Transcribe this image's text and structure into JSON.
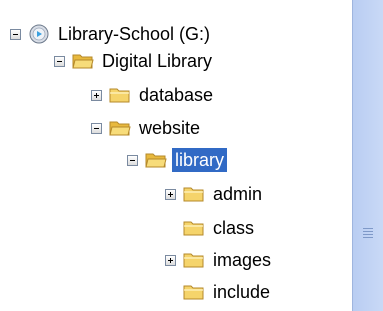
{
  "tree": {
    "items": [
      {
        "label": "Library-School (G:)",
        "icon": "drive-icon",
        "expander": "minus"
      },
      {
        "label": "Digital Library",
        "icon": "folder-open-icon",
        "expander": "minus"
      },
      {
        "label": "database",
        "icon": "folder-icon",
        "expander": "plus"
      },
      {
        "label": "website",
        "icon": "folder-open-icon",
        "expander": "minus"
      },
      {
        "label": "library",
        "icon": "folder-open-icon",
        "expander": "minus",
        "selected": true
      },
      {
        "label": "admin",
        "icon": "folder-icon",
        "expander": "plus"
      },
      {
        "label": "class",
        "icon": "folder-icon",
        "expander": "none"
      },
      {
        "label": "images",
        "icon": "folder-icon",
        "expander": "plus"
      },
      {
        "label": "include",
        "icon": "folder-icon",
        "expander": "none"
      }
    ]
  },
  "colors": {
    "selection": "#316ac5",
    "scrollbar": "#c1d3f5",
    "folder": "#f5d46b"
  }
}
